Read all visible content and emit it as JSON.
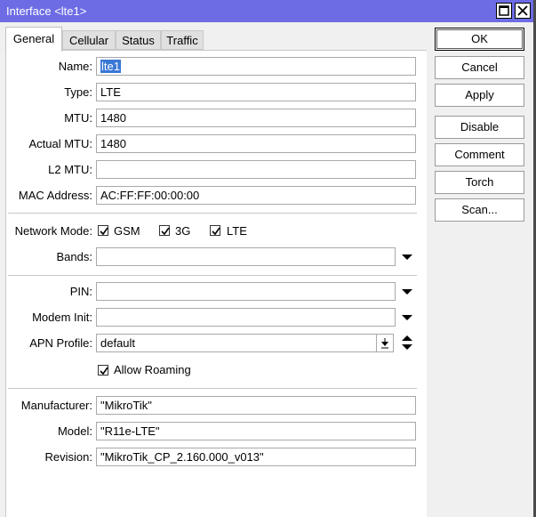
{
  "window": {
    "title": "Interface <lte1>"
  },
  "tabs": [
    {
      "label": "General",
      "active": true
    },
    {
      "label": "Cellular",
      "active": false
    },
    {
      "label": "Status",
      "active": false
    },
    {
      "label": "Traffic",
      "active": false
    }
  ],
  "fields": {
    "name": {
      "label": "Name:",
      "value": "lte1"
    },
    "type": {
      "label": "Type:",
      "value": "LTE"
    },
    "mtu": {
      "label": "MTU:",
      "value": "1480"
    },
    "actual_mtu": {
      "label": "Actual MTU:",
      "value": "1480"
    },
    "l2_mtu": {
      "label": "L2 MTU:",
      "value": ""
    },
    "mac_address": {
      "label": "MAC Address:",
      "value": "AC:FF:FF:00:00:00"
    }
  },
  "network_mode": {
    "label": "Network Mode:",
    "options": [
      {
        "label": "GSM",
        "checked": true
      },
      {
        "label": "3G",
        "checked": true
      },
      {
        "label": "LTE",
        "checked": true
      }
    ]
  },
  "bands": {
    "label": "Bands:",
    "value": ""
  },
  "pin": {
    "label": "PIN:",
    "value": ""
  },
  "modem_init": {
    "label": "Modem Init:",
    "value": ""
  },
  "apn_profile": {
    "label": "APN Profile:",
    "value": "default"
  },
  "allow_roaming": {
    "label": "Allow Roaming",
    "checked": true
  },
  "info": {
    "manufacturer": {
      "label": "Manufacturer:",
      "value": "\"MikroTik\""
    },
    "model": {
      "label": "Model:",
      "value": "\"R11e-LTE\""
    },
    "revision": {
      "label": "Revision:",
      "value": "\"MikroTik_CP_2.160.000_v013\""
    }
  },
  "buttons": {
    "ok": "OK",
    "cancel": "Cancel",
    "apply": "Apply",
    "disable": "Disable",
    "comment": "Comment",
    "torch": "Torch",
    "scan": "Scan..."
  },
  "colors": {
    "titlebar": "#6d6ce4",
    "selection": "#3a78d6"
  }
}
